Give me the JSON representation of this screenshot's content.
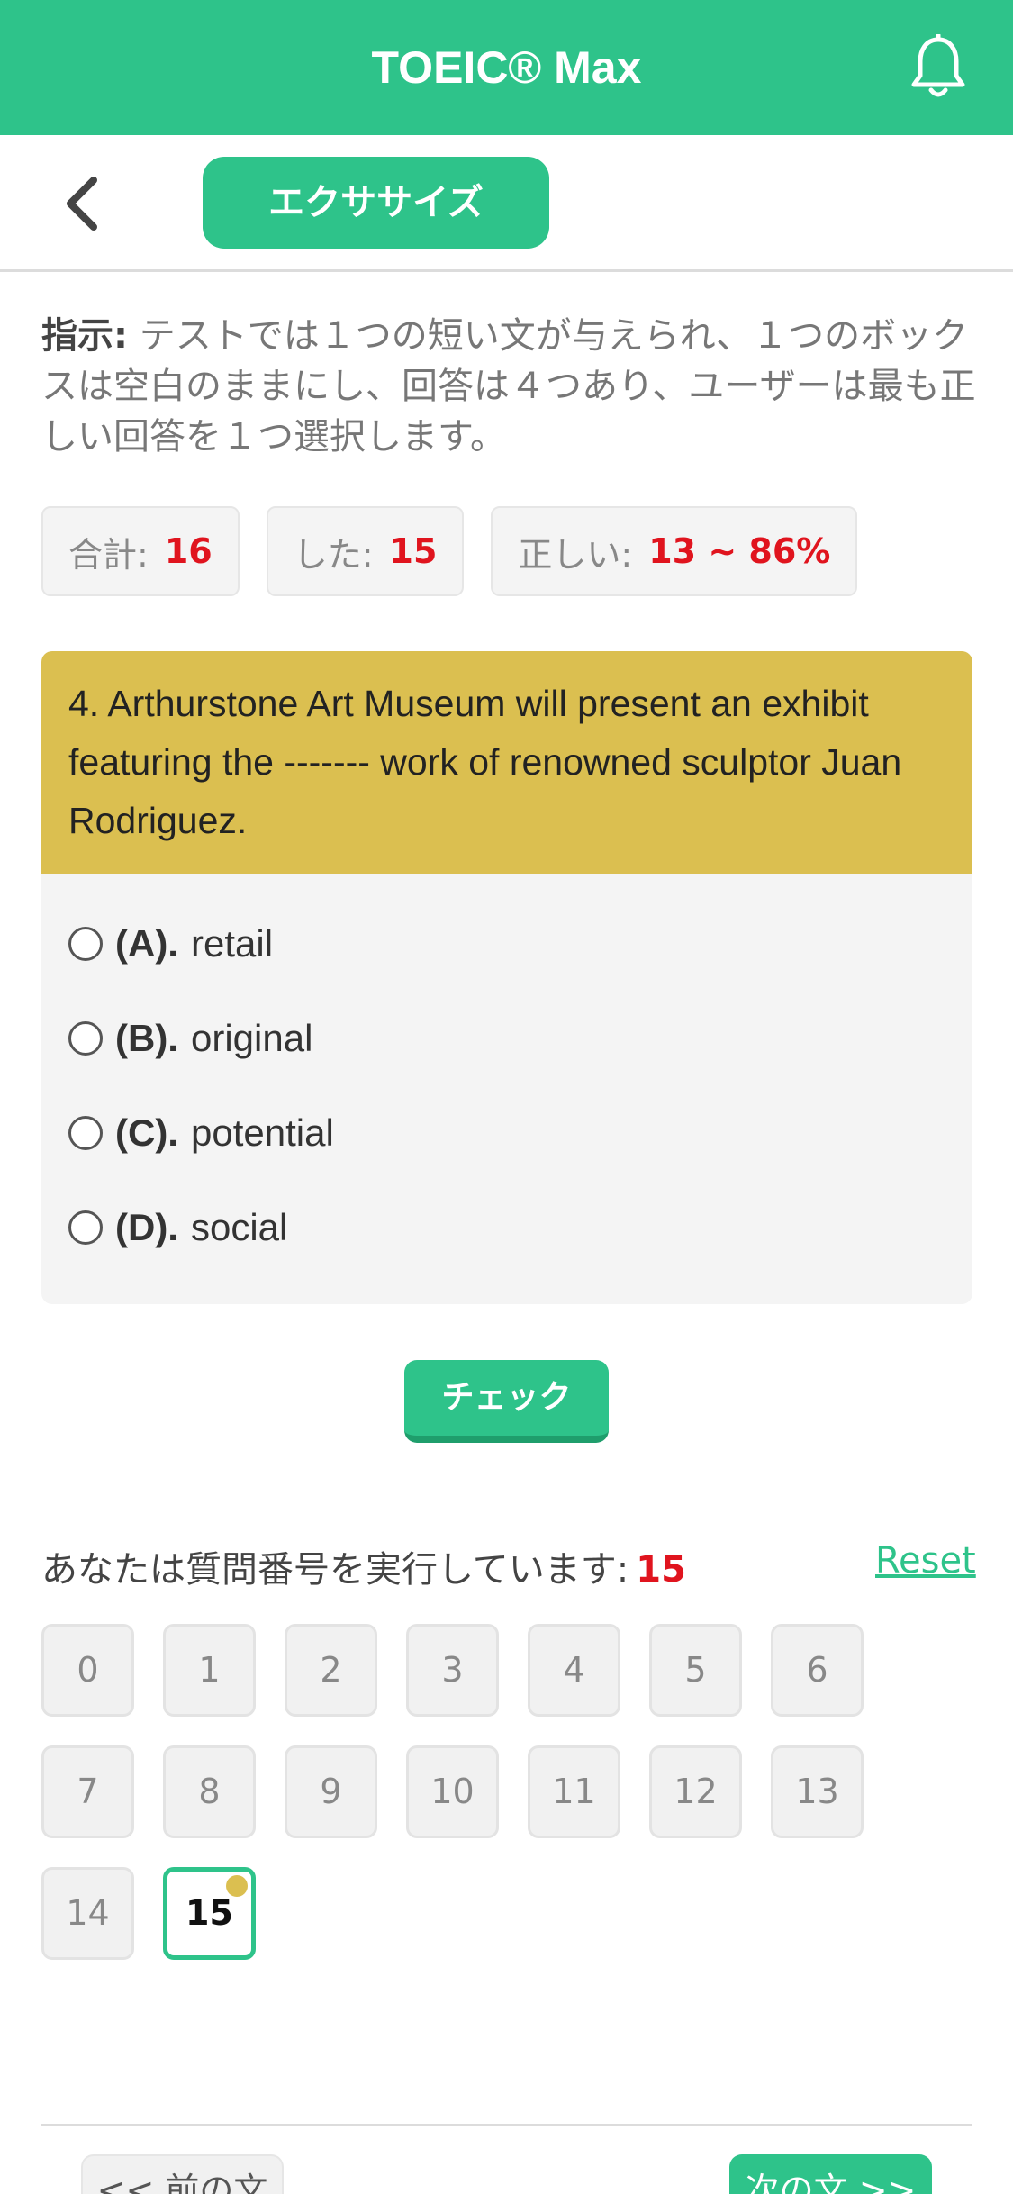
{
  "header": {
    "title": "TOEIC® Max",
    "icons": {
      "notification": "bell-icon"
    }
  },
  "toolbar": {
    "back_icon": "chevron-left-icon",
    "tab_label": "エクササイズ"
  },
  "instruction": {
    "label": "指示:",
    "text": " テストでは１つの短い文が与えられ、１つのボックスは空白のままにし、回答は４つあり、ユーザーは最も正しい回答を１つ選択します。"
  },
  "stats": {
    "total_label": "合計:",
    "total_value": "16",
    "done_label": "した:",
    "done_value": "15",
    "correct_label": "正しい:",
    "correct_value": "13 ~ 86%"
  },
  "question": {
    "text": "4. Arthurstone Art Museum will present an exhibit featuring the ------- work of renowned sculptor Juan Rodriguez.",
    "options": [
      {
        "key": "(A).",
        "text": "retail"
      },
      {
        "key": "(B).",
        "text": "original"
      },
      {
        "key": "(C).",
        "text": "potential"
      },
      {
        "key": "(D).",
        "text": "social"
      }
    ]
  },
  "check_label": "チェック",
  "progress": {
    "label": "あなたは質問番号を実行しています:",
    "current": "15",
    "reset_label": "Reset"
  },
  "numbers": [
    "0",
    "1",
    "2",
    "3",
    "4",
    "5",
    "6",
    "7",
    "8",
    "9",
    "10",
    "11",
    "12",
    "13",
    "14",
    "15"
  ],
  "nav": {
    "prev_label": "<< 前の文",
    "next_label": "次の文 >>"
  },
  "colors": {
    "primary": "#2ec38a",
    "question_bg": "#dbbf50",
    "highlight_red": "#e0141e"
  }
}
